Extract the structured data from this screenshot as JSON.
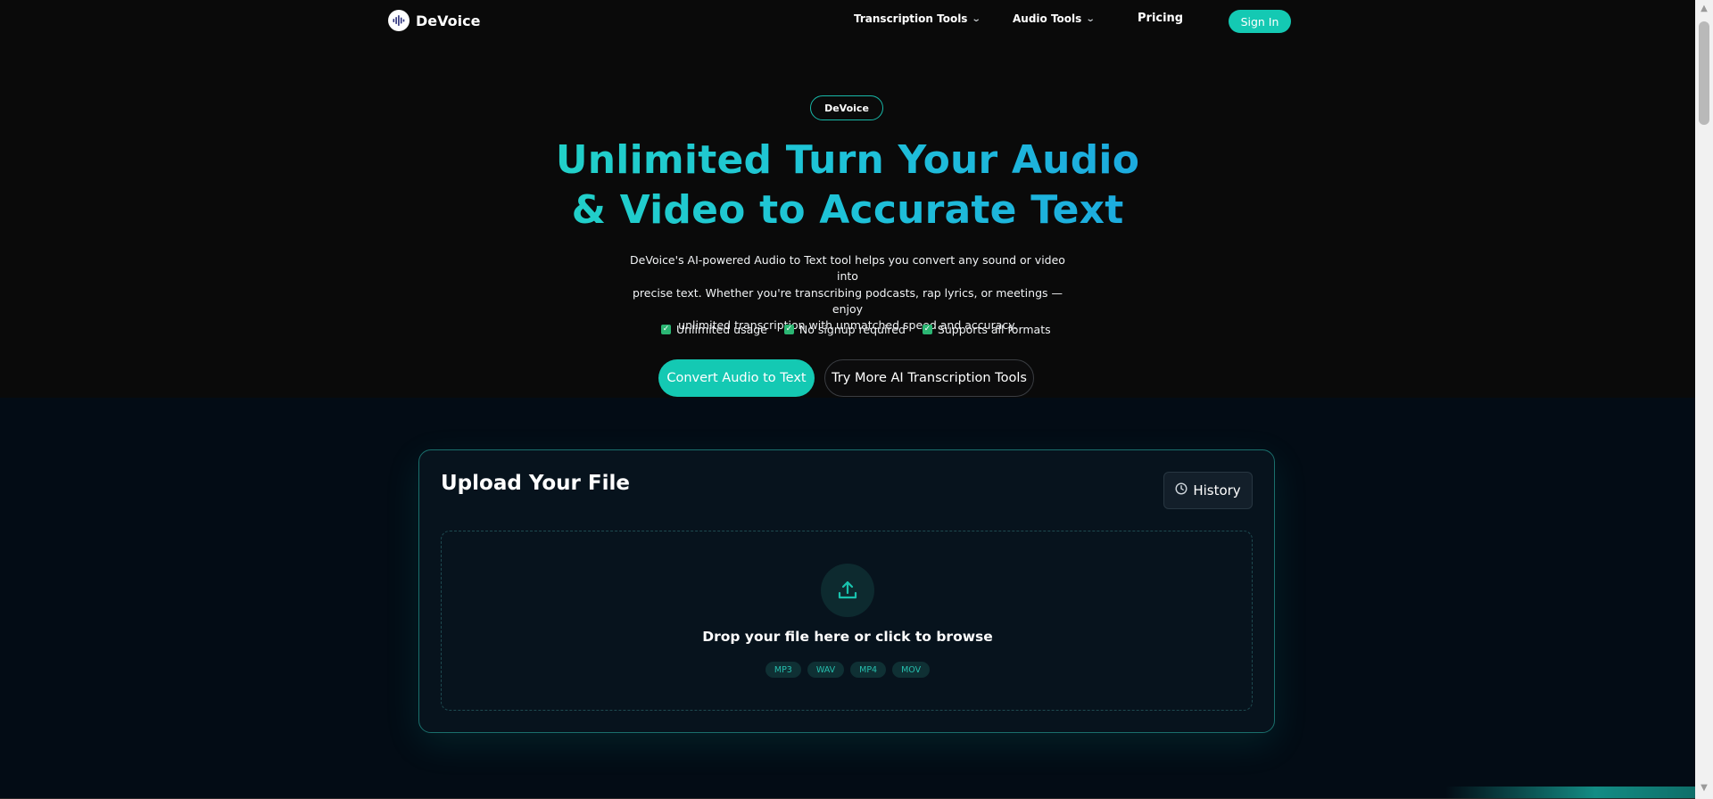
{
  "nav": {
    "brand": "DeVoice",
    "items": [
      {
        "label": "Transcription Tools",
        "has_dropdown": true
      },
      {
        "label": "Audio Tools",
        "has_dropdown": true
      },
      {
        "label": "Pricing",
        "has_dropdown": false
      }
    ],
    "sign_in": "Sign In"
  },
  "hero": {
    "badge": "DeVoice",
    "headline_line1": "Unlimited Turn Your Audio",
    "headline_line2": "& Video to Accurate Text",
    "subtitle_line1": "DeVoice's AI-powered Audio to Text tool helps you convert any sound or video into",
    "subtitle_line2": "precise text. Whether you're transcribing podcasts, rap lyrics, or meetings — enjoy",
    "subtitle_line3": "unlimited transcription with unmatched speed and accuracy.",
    "features": [
      "Unlimited usage",
      "No signup required",
      "Supports all formats"
    ],
    "primary_cta": "Convert Audio to Text",
    "secondary_cta": "Try More AI Transcription Tools"
  },
  "upload": {
    "title": "Upload Your File",
    "history_label": "History",
    "drop_text": "Drop your file here or click to browse",
    "formats": [
      "MP3",
      "WAV",
      "MP4",
      "MOV"
    ]
  },
  "colors": {
    "accent": "#14c9b3",
    "headline_gradient_start": "#22d3c5",
    "headline_gradient_end": "#1ca6e0",
    "background": "#0a0a0a",
    "card_background": "#07131d"
  },
  "icons": {
    "logo": "sound-wave-icon",
    "dropdown": "chevron-down-icon",
    "check": "checkbox-checked-icon",
    "history": "clock-icon",
    "upload": "upload-icon"
  }
}
